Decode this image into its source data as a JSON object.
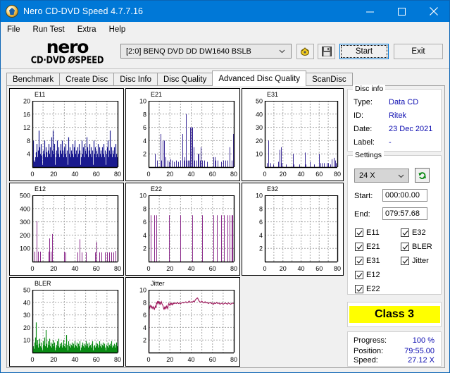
{
  "window": {
    "title": "Nero CD-DVD Speed 4.7.7.16",
    "icon": "nero-disc-icon",
    "minimize_label": "Minimize",
    "maximize_label": "Maximize",
    "close_label": "Close"
  },
  "menubar": {
    "items": [
      {
        "label": "File",
        "accel": "F"
      },
      {
        "label": "Run Test",
        "accel": "R"
      },
      {
        "label": "Extra",
        "accel": "E"
      },
      {
        "label": "Help",
        "accel": "H"
      }
    ]
  },
  "logo": {
    "word": "nero",
    "sub_left": "CD·DVD",
    "sub_right": "SPEED"
  },
  "toolbar": {
    "drive_value": "[2:0]   BENQ DVD DD DW1640 BSLB",
    "speed_button": "speed-icon",
    "save_button": "save-icon",
    "start_label": "Start",
    "start_accel": "S",
    "exit_label": "Exit",
    "exit_accel": "x"
  },
  "tabs": [
    {
      "label": "Benchmark",
      "active": false
    },
    {
      "label": "Create Disc",
      "active": false
    },
    {
      "label": "Disc Info",
      "active": false
    },
    {
      "label": "Disc Quality",
      "active": false
    },
    {
      "label": "Advanced Disc Quality",
      "active": true
    },
    {
      "label": "ScanDisc",
      "active": false
    }
  ],
  "disc_info": {
    "legend": "Disc info",
    "rows": [
      {
        "key": "Type:",
        "value": "Data CD"
      },
      {
        "key": "ID:",
        "value": "Ritek"
      },
      {
        "key": "Date:",
        "value": "23 Dec 2021"
      },
      {
        "key": "Label:",
        "value": "-"
      }
    ]
  },
  "settings": {
    "legend": "Settings",
    "speed_value": "24 X",
    "refresh_icon": "refresh-icon",
    "start_label": "Start:",
    "start_value": "000:00.00",
    "end_label": "End:",
    "end_value": "079:57.68",
    "checkboxes_left": [
      {
        "label": "E11",
        "checked": true
      },
      {
        "label": "E21",
        "checked": true
      },
      {
        "label": "E31",
        "checked": true
      },
      {
        "label": "E12",
        "checked": true
      },
      {
        "label": "E22",
        "checked": true
      }
    ],
    "checkboxes_right": [
      {
        "label": "E32",
        "checked": true
      },
      {
        "label": "BLER",
        "checked": true
      },
      {
        "label": "Jitter",
        "checked": true
      }
    ]
  },
  "class_result": {
    "label": "Class 3",
    "bg": "#ffff00"
  },
  "status": {
    "rows": [
      {
        "key": "Progress:",
        "value": "100 %"
      },
      {
        "key": "Position:",
        "value": "79:55.00"
      },
      {
        "key": "Speed:",
        "value": "27.12 X"
      }
    ]
  },
  "chart_data": [
    {
      "id": "E11",
      "type": "bar",
      "title": "E11",
      "color": "#1b1b8f",
      "fill": true,
      "xlabel": "",
      "ylabel": "",
      "xlim": [
        0,
        80
      ],
      "ylim": [
        0,
        20
      ],
      "xticks": [
        0,
        20,
        40,
        60,
        80
      ],
      "yticks": [
        4,
        8,
        12,
        16,
        20
      ],
      "grid": true,
      "x": [
        0.5,
        1.2,
        1.9,
        2.6,
        3.3,
        4,
        4.7,
        5.4,
        6.1,
        6.8,
        7.5,
        8.2,
        8.9,
        9.6,
        10.3,
        11,
        11.7,
        12.4,
        13.1,
        13.8,
        14.5,
        15.2,
        15.9,
        16.6,
        17.3,
        18,
        18.7,
        19.4,
        20.1,
        20.8,
        21.5,
        22.2,
        22.9,
        23.6,
        24.3,
        25,
        25.7,
        26.4,
        27.1,
        27.8,
        28.5,
        29.2,
        29.9,
        30.6,
        31.3,
        32,
        32.7,
        33.4,
        34.1,
        34.8,
        35.5,
        36.2,
        36.9,
        37.6,
        38.3,
        39,
        39.7,
        40.4,
        41.1,
        41.8,
        42.5,
        43.2,
        43.9,
        44.6,
        45.3,
        46,
        46.7,
        47.4,
        48.1,
        48.8,
        49.5,
        50.2,
        50.9,
        51.6,
        52.3,
        53,
        53.7,
        54.4,
        55.1,
        55.8,
        56.5,
        57.2,
        57.9,
        58.6,
        59.3,
        60,
        60.7,
        61.4,
        62.1,
        62.8,
        63.5,
        64.2,
        64.9,
        65.6,
        66.3,
        67,
        67.7,
        68.4,
        69.1,
        69.8,
        70.5,
        71.2,
        71.9,
        72.6,
        73.3,
        74,
        74.7,
        75.4,
        76.1,
        76.8,
        77.5,
        78.2,
        78.9,
        79.6
      ],
      "values": [
        8,
        2,
        1.5,
        3,
        4.5,
        7,
        3,
        5,
        11,
        6,
        4,
        7,
        3.5,
        5,
        4,
        8,
        3,
        6,
        4.5,
        3,
        5,
        7,
        4,
        6,
        3,
        9,
        5,
        11,
        4,
        7,
        3,
        5,
        8,
        4,
        6,
        3,
        5,
        7,
        4,
        8,
        5,
        3,
        6,
        4,
        7,
        3,
        5,
        9,
        4,
        6,
        3,
        5,
        4,
        7,
        3,
        6,
        8,
        4,
        5,
        3,
        6,
        4,
        7,
        5,
        3,
        8,
        4,
        6,
        3,
        7,
        5,
        4,
        9,
        6,
        3,
        5,
        7,
        4,
        6,
        3,
        5,
        8,
        4,
        6,
        3,
        5,
        4,
        7,
        3,
        6,
        4,
        5,
        3,
        6,
        4,
        7,
        3,
        5,
        4,
        6,
        8,
        3,
        5,
        11,
        4,
        6,
        3,
        5,
        4,
        6,
        3,
        7,
        4,
        3
      ]
    },
    {
      "id": "E21",
      "type": "bar",
      "title": "E21",
      "color": "#3c2c96",
      "fill": false,
      "xlim": [
        0,
        80
      ],
      "ylim": [
        0,
        10
      ],
      "xticks": [
        0,
        20,
        40,
        60,
        80
      ],
      "yticks": [
        2,
        4,
        6,
        8,
        10
      ],
      "grid": true,
      "x": [
        6,
        8,
        11,
        12,
        13,
        14.5,
        16,
        18,
        19,
        20.5,
        22,
        24,
        26,
        28,
        30,
        32,
        33,
        34,
        35,
        36,
        37,
        38.5,
        39,
        40,
        41,
        42,
        43,
        45,
        46,
        47,
        48,
        49,
        50,
        52,
        55,
        61,
        62,
        63,
        65,
        68,
        70,
        72,
        74,
        76,
        78,
        79.5
      ],
      "values": [
        2,
        1,
        5,
        1,
        4,
        4,
        1.5,
        1,
        0.8,
        1.2,
        1,
        0.8,
        1,
        0.8,
        1,
        5,
        1,
        1.5,
        8,
        1,
        1,
        1,
        6,
        6,
        6,
        3,
        1,
        1,
        2,
        2,
        1,
        3,
        1,
        1,
        0.8,
        1.5,
        1.5,
        1,
        1,
        0.8,
        1,
        1,
        1,
        3,
        1,
        5
      ]
    },
    {
      "id": "E31",
      "type": "bar",
      "title": "E31",
      "color": "#3c2c96",
      "fill": false,
      "xlim": [
        0,
        80
      ],
      "ylim": [
        0,
        50
      ],
      "xticks": [
        0,
        20,
        40,
        60,
        80
      ],
      "yticks": [
        10,
        20,
        30,
        40,
        50
      ],
      "grid": true,
      "x": [
        2,
        4,
        6,
        9,
        15,
        16.5,
        17.5,
        19,
        23,
        31,
        32,
        38,
        44,
        45,
        50,
        54,
        59.5,
        61,
        63,
        65,
        68,
        70,
        72,
        74,
        76,
        77.5,
        78.5
      ],
      "values": [
        3,
        20,
        3,
        2,
        4,
        13,
        15,
        3,
        2,
        10,
        2,
        2,
        11,
        2,
        4,
        2,
        10,
        3,
        3,
        3,
        3,
        3,
        2,
        6,
        7,
        5,
        3
      ]
    },
    {
      "id": "E12",
      "type": "bar",
      "title": "E12",
      "color": "#8c2c8c",
      "fill": false,
      "xlim": [
        0,
        80
      ],
      "ylim": [
        0,
        500
      ],
      "xticks": [
        0,
        20,
        40,
        60,
        80
      ],
      "yticks": [
        100,
        200,
        300,
        400,
        500
      ],
      "grid": true,
      "x": [
        2,
        4,
        5,
        7,
        15,
        16,
        17.5,
        18.5,
        30,
        31,
        42,
        44,
        46,
        50,
        59,
        60,
        63,
        65,
        68,
        70,
        72,
        74,
        76,
        78
      ],
      "values": [
        75,
        305,
        75,
        75,
        75,
        175,
        75,
        208,
        75,
        70,
        70,
        168,
        70,
        70,
        70,
        148,
        70,
        70,
        70,
        70,
        70,
        70,
        70,
        80
      ]
    },
    {
      "id": "E22",
      "type": "bar",
      "title": "E22",
      "color": "#8c2c8c",
      "fill": false,
      "xlim": [
        0,
        80
      ],
      "ylim": [
        0,
        10
      ],
      "xticks": [
        0,
        20,
        40,
        60,
        80
      ],
      "yticks": [
        2,
        4,
        6,
        8,
        10
      ],
      "grid": true,
      "x": [
        2,
        5,
        7,
        19,
        30,
        41,
        50,
        61,
        64,
        68,
        71,
        74,
        76,
        78,
        79
      ],
      "values": [
        7,
        7,
        7,
        7,
        7,
        7,
        7,
        7,
        7,
        7,
        7,
        7,
        7,
        7,
        7
      ]
    },
    {
      "id": "E32",
      "type": "bar",
      "title": "E32",
      "color": "#3c2c96",
      "fill": false,
      "xlim": [
        0,
        80
      ],
      "ylim": [
        0,
        10
      ],
      "xticks": [
        0,
        20,
        40,
        60,
        80
      ],
      "yticks": [
        2,
        4,
        6,
        8,
        10
      ],
      "grid": true,
      "x": [],
      "values": []
    },
    {
      "id": "BLER",
      "type": "bar",
      "title": "BLER",
      "color": "#0a8a14",
      "fill": true,
      "xlim": [
        0,
        80
      ],
      "ylim": [
        0,
        50
      ],
      "xticks": [
        0,
        20,
        40,
        60,
        80
      ],
      "yticks": [
        10,
        20,
        30,
        40,
        50
      ],
      "grid": true,
      "x": [
        0.5,
        1.2,
        1.9,
        2.6,
        3.3,
        4,
        4.7,
        5.4,
        6.1,
        6.8,
        7.5,
        8.2,
        8.9,
        9.6,
        10.3,
        11,
        11.7,
        12.4,
        13.1,
        13.8,
        14.5,
        15.2,
        15.9,
        16.6,
        17.3,
        18,
        18.7,
        19.4,
        20.1,
        20.8,
        21.5,
        22.2,
        22.9,
        23.6,
        24.3,
        25,
        25.7,
        26.4,
        27.1,
        27.8,
        28.5,
        29.2,
        29.9,
        30.6,
        31.3,
        32,
        32.7,
        33.4,
        34.1,
        34.8,
        35.5,
        36.2,
        36.9,
        37.6,
        38.3,
        39,
        39.7,
        40.4,
        41.1,
        41.8,
        42.5,
        43.2,
        43.9,
        44.6,
        45.3,
        46,
        46.7,
        47.4,
        48.1,
        48.8,
        49.5,
        50.2,
        50.9,
        51.6,
        52.3,
        53,
        53.7,
        54.4,
        55.1,
        55.8,
        56.5,
        57.2,
        57.9,
        58.6,
        59.3,
        60,
        60.7,
        61.4,
        62.1,
        62.8,
        63.5,
        64.2,
        64.9,
        65.6,
        66.3,
        67,
        67.7,
        68.4,
        69.1,
        69.8,
        70.5,
        71.2,
        71.9,
        72.6,
        73.3,
        74,
        74.7,
        75.4,
        76.1,
        76.8,
        77.5,
        78.2,
        78.9,
        79.6
      ],
      "values": [
        5,
        3,
        8,
        12,
        24,
        6,
        10,
        4,
        7,
        11,
        5,
        8,
        4,
        9,
        6,
        12,
        5,
        18,
        7,
        4,
        9,
        6,
        11,
        5,
        8,
        4,
        7,
        10,
        5,
        8,
        4,
        6,
        9,
        5,
        11,
        4,
        7,
        5,
        8,
        4,
        6,
        10,
        5,
        7,
        4,
        14,
        6,
        9,
        5,
        7,
        4,
        6,
        8,
        5,
        7,
        4,
        9,
        6,
        5,
        8,
        4,
        7,
        5,
        9,
        4,
        6,
        8,
        5,
        7,
        4,
        6,
        9,
        5,
        7,
        4,
        8,
        5,
        6,
        4,
        7,
        9,
        5,
        6,
        4,
        8,
        5,
        7,
        4,
        6,
        9,
        5,
        7,
        4,
        6,
        8,
        5,
        7,
        4,
        6,
        5,
        8,
        4,
        6,
        7,
        5,
        9,
        4,
        6,
        5,
        7,
        4,
        6,
        8,
        5,
        4
      ]
    },
    {
      "id": "Jitter",
      "type": "line",
      "title": "Jitter",
      "color": "#9c1459",
      "fill": false,
      "xlim": [
        0,
        80
      ],
      "ylim": [
        0,
        10
      ],
      "xticks": [
        0,
        20,
        40,
        60,
        80
      ],
      "yticks": [
        2,
        4,
        6,
        8,
        10
      ],
      "grid": true,
      "x": [
        0.3,
        0.6,
        1,
        1.5,
        2,
        2.5,
        3,
        3.5,
        4,
        4.5,
        5,
        5.5,
        6,
        6.5,
        7,
        7.5,
        8,
        8.5,
        9,
        9.5,
        10,
        10.5,
        11,
        11.5,
        12,
        12.5,
        13,
        13.5,
        14,
        14.5,
        15,
        15.5,
        16,
        16.5,
        17,
        17.5,
        18,
        18.5,
        19,
        19.5,
        20,
        20.5,
        21,
        21.5,
        22,
        22.5,
        23,
        23.5,
        24,
        25,
        26,
        27,
        28,
        29,
        30,
        31,
        32,
        33,
        34,
        35,
        36,
        37,
        38,
        39,
        40,
        41,
        42,
        43,
        44,
        45,
        46,
        47,
        48,
        49,
        50,
        51,
        52,
        53,
        54,
        55,
        56,
        57,
        58,
        59,
        60,
        61,
        62,
        63,
        64,
        65,
        66,
        67,
        68,
        69,
        70,
        71,
        72,
        73,
        74,
        75,
        76,
        77,
        78,
        79,
        79.8
      ],
      "values": [
        0,
        6.8,
        7.2,
        7.5,
        7.3,
        7.1,
        7.4,
        7.2,
        7.0,
        7.3,
        7.1,
        6.9,
        7.2,
        7.4,
        7.1,
        8.0,
        7.8,
        8.2,
        7.9,
        8.1,
        7.8,
        8.0,
        7.7,
        7.9,
        8.1,
        7.8,
        7.6,
        7.5,
        7.1,
        6.9,
        7.2,
        7.0,
        7.3,
        7.1,
        7.4,
        7.2,
        7.0,
        7.6,
        7.8,
        7.6,
        7.5,
        7.9,
        7.7,
        7.8,
        7.6,
        7.8,
        7.7,
        7.9,
        7.8,
        7.9,
        7.8,
        8.0,
        7.8,
        7.9,
        7.8,
        7.9,
        8.0,
        7.9,
        8.0,
        8.1,
        7.9,
        8.0,
        8.2,
        8.0,
        8.1,
        8.0,
        8.2,
        8.1,
        8.4,
        8.6,
        8.7,
        8.3,
        8.1,
        8.0,
        8.2,
        8.0,
        7.9,
        8.1,
        7.9,
        8.0,
        7.8,
        7.9,
        8.0,
        7.8,
        7.9,
        7.7,
        7.9,
        7.8,
        8.0,
        7.8,
        7.9,
        7.7,
        7.8,
        7.9,
        7.7,
        7.8,
        7.9,
        7.8,
        7.7,
        7.9,
        7.8,
        7.7,
        7.8,
        7.9,
        7.8,
        7.7,
        7.6
      ]
    }
  ]
}
